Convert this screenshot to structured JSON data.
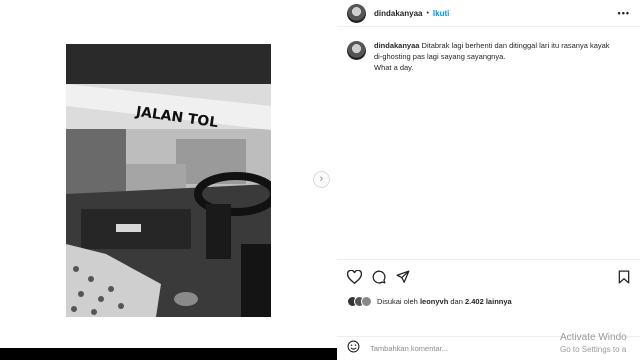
{
  "post": {
    "username": "dindakanyaa",
    "separator": "•",
    "follow_label": "Ikuti",
    "more_label": "•••",
    "photo_overlay_text": "JALAN TOL",
    "caption_username": "dindakanyaa",
    "caption_text": "Ditabrak lagi berhenti dan ditinggal lari itu rasanya kayak di-ghosting pas lagi sayang sayangnya.",
    "caption_line2": "What a day.",
    "next_arrow": "›"
  },
  "likes": {
    "prefix": "Disukai oleh",
    "user": "leonyvh",
    "conjunction": "dan",
    "count": "2.402 lainnya"
  },
  "comment": {
    "placeholder": "Tambahkan komentar..."
  },
  "watermark": {
    "line1": "Activate Windo",
    "line2": "Go to Settings to a"
  },
  "icons": {
    "like": "heart-icon",
    "comment": "comment-icon",
    "share": "paper-plane-icon",
    "save": "bookmark-icon",
    "emoji": "emoji-icon",
    "more": "more-options-icon"
  }
}
